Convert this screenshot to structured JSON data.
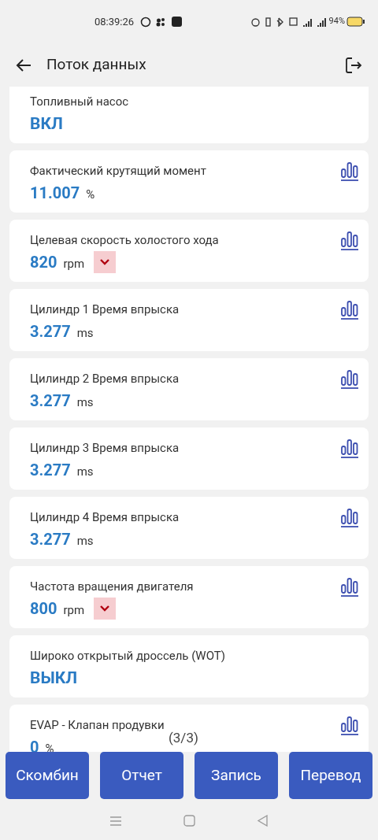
{
  "status_bar": {
    "time": "08:39:26",
    "battery": "94%"
  },
  "header": {
    "title": "Поток данных"
  },
  "items": [
    {
      "kind": "state",
      "label": "Топливный насос",
      "value": "ВКЛ",
      "chart": false
    },
    {
      "kind": "value",
      "label": "Фактический крутящий момент",
      "value": "11.007",
      "unit": "%",
      "chart": true
    },
    {
      "kind": "value",
      "label": "Целевая скорость холостого хода",
      "value": "820",
      "unit": "rpm",
      "chart": true,
      "falling": true
    },
    {
      "kind": "value",
      "label": "Цилиндр 1 Время впрыска",
      "value": "3.277",
      "unit": "ms",
      "chart": true
    },
    {
      "kind": "value",
      "label": "Цилиндр 2 Время впрыска",
      "value": "3.277",
      "unit": "ms",
      "chart": true
    },
    {
      "kind": "value",
      "label": "Цилиндр 3 Время впрыска",
      "value": "3.277",
      "unit": "ms",
      "chart": true
    },
    {
      "kind": "value",
      "label": "Цилиндр 4 Время впрыска",
      "value": "3.277",
      "unit": "ms",
      "chart": true
    },
    {
      "kind": "value",
      "label": "Частота вращения двигателя",
      "value": "800",
      "unit": "rpm",
      "chart": true,
      "falling": true
    },
    {
      "kind": "state",
      "label": "Широко открытый дроссель (WOT)",
      "value": "ВЫКЛ",
      "chart": false
    },
    {
      "kind": "value",
      "label": "EVAP - Клапан продувки",
      "value": "0",
      "unit": "%",
      "chart": true
    }
  ],
  "page_indicator": "(3/3)",
  "buttons": [
    "Скомбин",
    "Отчет",
    "Запись",
    "Перевод"
  ]
}
